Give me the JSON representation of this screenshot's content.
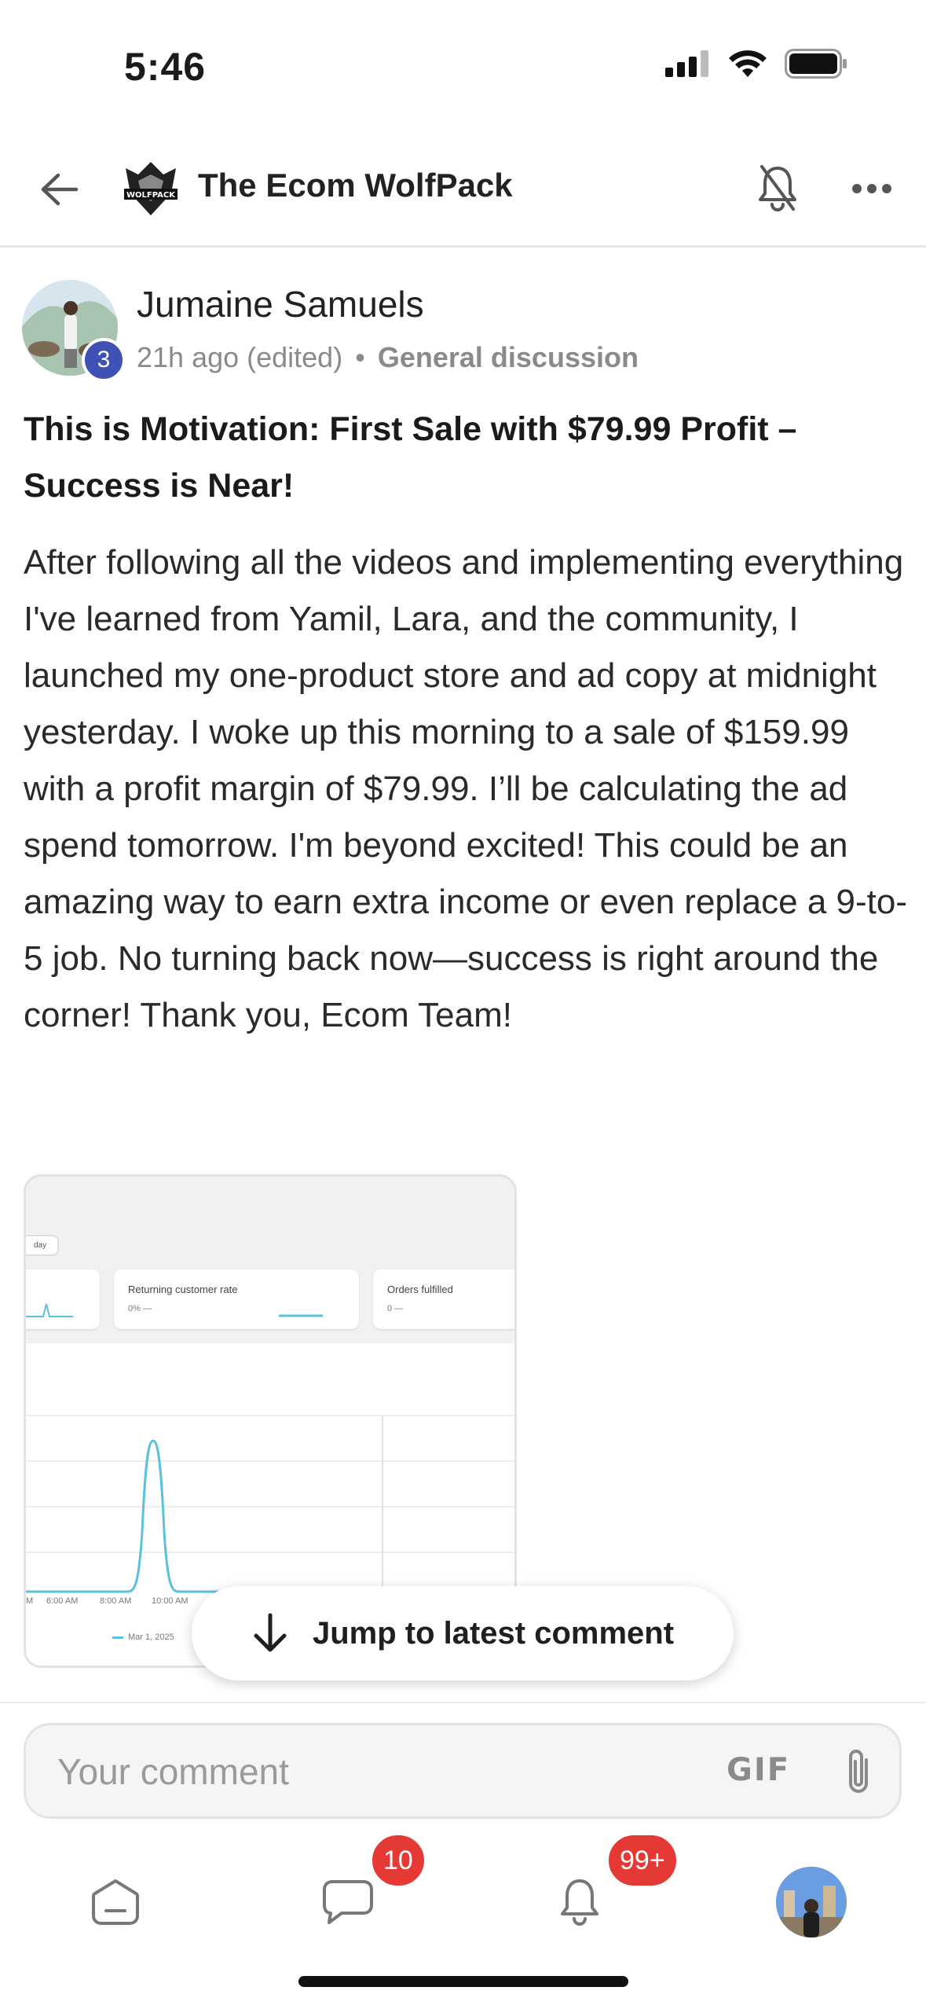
{
  "status_bar": {
    "time": "5:46"
  },
  "header": {
    "group_title": "The Ecom WolfPack",
    "logo_text": "WOLFPACK"
  },
  "post": {
    "author": "Jumaine Samuels",
    "level": "3",
    "time": "21h ago (edited)",
    "separator": "•",
    "category": "General discussion",
    "title": "This is Motivation: First Sale with $79.99 Profit – Success is Near!",
    "body": "After following all the videos and implementing everything I've learned from Yamil, Lara, and the community, I launched my one-product store and ad copy at midnight yesterday. I woke up this morning to a sale of $159.99 with a profit margin of $79.99. I’ll be calculating the ad spend tomorrow. I'm beyond excited! This could be an amazing way to earn extra income or even replace a 9-to-5 job. No turning back now—success is right around the corner! Thank you, Ecom Team!",
    "attachment": {
      "chip": "day",
      "cards": [
        {
          "label": "",
          "value": ""
        },
        {
          "label": "Returning customer rate",
          "value": "0% —"
        },
        {
          "label": "Orders fulfilled",
          "value": "0 —"
        }
      ],
      "x_labels": [
        "M",
        "6:00 AM",
        "8:00 AM",
        "10:00 AM"
      ],
      "legend": "Mar 1, 2025"
    }
  },
  "jump_button": {
    "label": "Jump to latest comment"
  },
  "comment_bar": {
    "placeholder": "Your comment",
    "gif_label": "GIF"
  },
  "bottom_nav": {
    "chat_badge": "10",
    "notifications_badge": "99+"
  },
  "colors": {
    "badge_red": "#e53935",
    "level_blue": "#3f51b5",
    "chart_line": "#5bc0de"
  }
}
